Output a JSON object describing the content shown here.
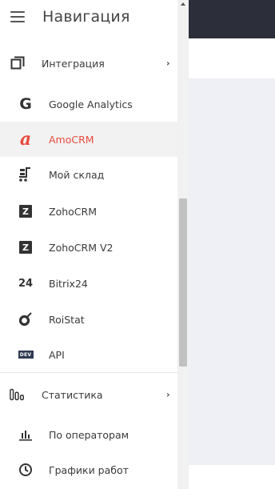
{
  "drawer": {
    "title": "Навигация",
    "sections": {
      "integration": {
        "label": "Интеграция"
      },
      "statistics": {
        "label": "Статистика"
      }
    },
    "integration_items": [
      {
        "label": "Google Analytics",
        "icon": "google-g-icon"
      },
      {
        "label": "AmoCRM",
        "icon": "amocrm-a-icon",
        "active": true
      },
      {
        "label": "Мой склад",
        "icon": "warehouse-cart-icon"
      },
      {
        "label": "ZohoCRM",
        "icon": "zoho-z-icon"
      },
      {
        "label": "ZohoCRM V2",
        "icon": "zoho-z-icon"
      },
      {
        "label": "Bitrix24",
        "icon": "bitrix24-icon"
      },
      {
        "label": "RoiStat",
        "icon": "roistat-icon"
      },
      {
        "label": "API",
        "icon": "dev-badge-icon"
      }
    ],
    "statistics_items": [
      {
        "label": "По операторам",
        "icon": "bar-chart-icon"
      },
      {
        "label": "Графики работ",
        "icon": "clock-icon"
      }
    ],
    "icon_glyphs": {
      "google": "G",
      "amocrm": "a",
      "zoho": "Z",
      "bitrix": "24",
      "dev": "DEV"
    }
  },
  "colors": {
    "active_accent": "#e94a3f",
    "active_bg": "#f2f2f2",
    "topbar_dark": "#2c2f3a",
    "content_bg": "#eef0f5"
  }
}
